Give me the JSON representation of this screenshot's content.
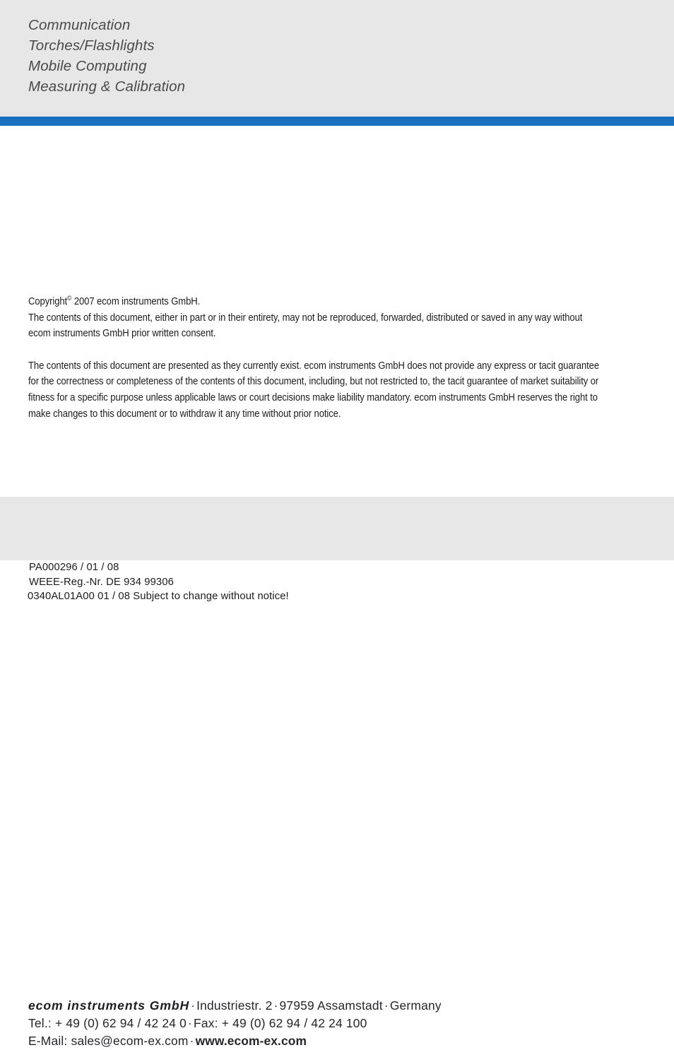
{
  "header": {
    "categories": [
      "Communication",
      "Torches/Flashlights",
      "Mobile Computing",
      "Measuring & Calibration"
    ],
    "rule_color": "#1870bf",
    "background_color": "#e7e7e7"
  },
  "legal": {
    "copyright_line_prefix": "Copyright",
    "copyright_symbol": "©",
    "copyright_line_suffix": " 2007 ecom instruments GmbH.",
    "paragraph1_line2": "The contents of this document, either in part or in their entirety, may not be reproduced, forwarded, distributed or saved in any way without",
    "paragraph1_line3": "ecom instruments GmbH prior written consent.",
    "paragraph2_line1": "The contents of this document are presented as they currently exist. ecom instruments GmbH does not provide any express or tacit guarantee",
    "paragraph2_line2": "for the correctness or completeness of the contents of this document, including, but not restricted to, the tacit guarantee of market suitability or",
    "paragraph2_line3": "fitness for a specific purpose unless applicable laws or court decisions make liability mandatory. ecom instruments GmbH reserves the right to",
    "paragraph2_line4": "make changes to this document or to withdraw it any time without prior notice."
  },
  "codes": {
    "part_number": "PA000296 / 01 / 08",
    "weee_registration": "WEEE-Reg.-Nr. DE 934 99306",
    "document_code": "0340AL01A00 01 / 08 Subject to change without notice!"
  },
  "footer": {
    "background_color": "#e7e7e7",
    "company_name": "ecom instruments GmbH",
    "separator": "·",
    "street": "Industriestr. 2",
    "city": "97959 Assamstadt",
    "country": "Germany",
    "tel_label": "Tel.:",
    "tel_number": "+ 49 (0) 62 94 / 42 24 0",
    "fax_label": "Fax:",
    "fax_number": "+ 49 (0) 62 94 / 42 24 100",
    "email_label": "E-Mail:",
    "email": "sales@ecom-ex.com",
    "website": "www.ecom-ex.com"
  }
}
